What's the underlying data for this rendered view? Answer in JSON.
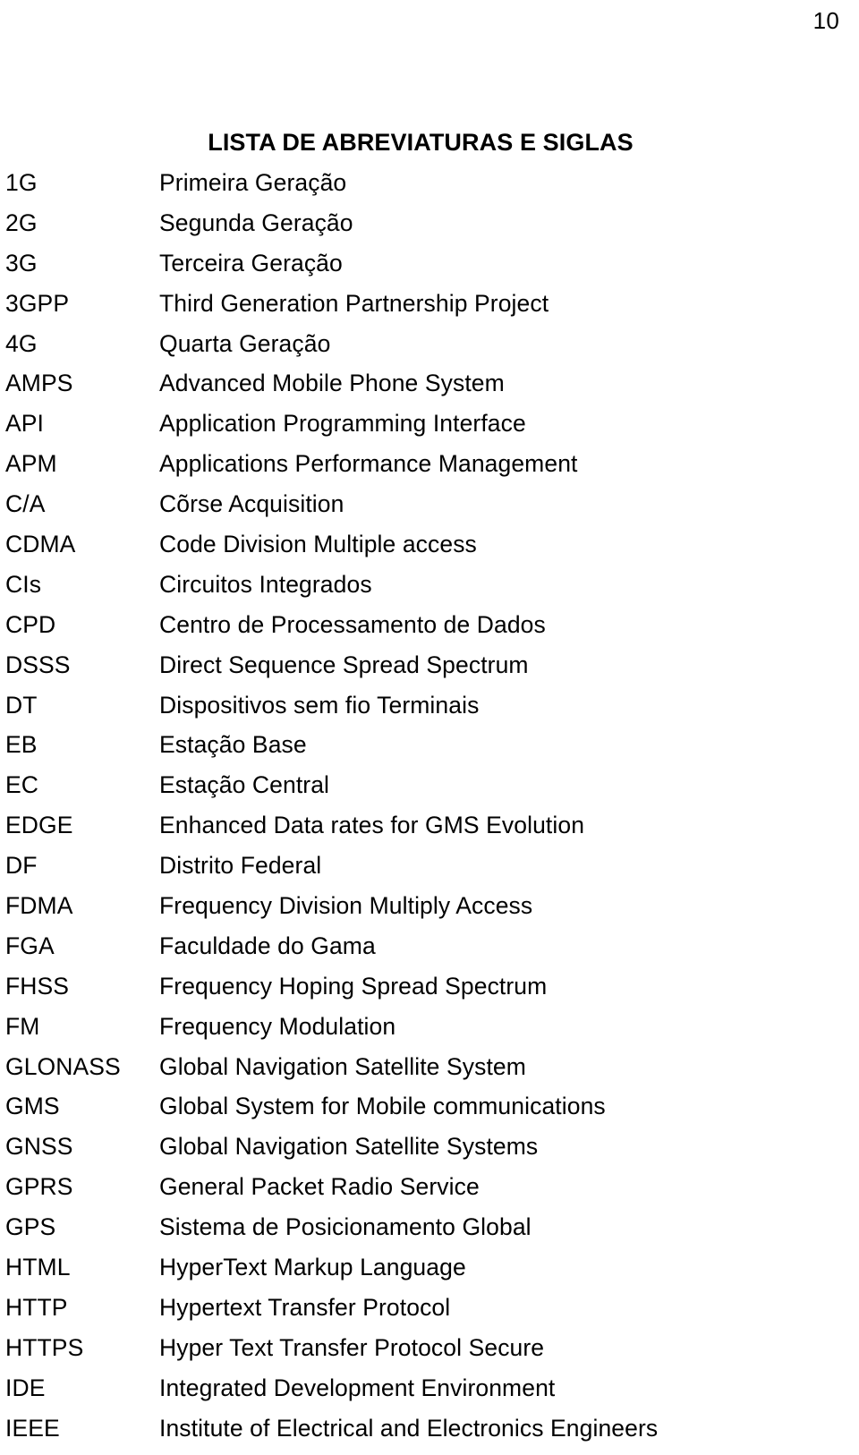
{
  "page": {
    "number": "10",
    "title": "LISTA DE ABREVIATURAS E SIGLAS"
  },
  "abbreviations": [
    {
      "term": "1G",
      "definition": "Primeira Geração"
    },
    {
      "term": "2G",
      "definition": "Segunda Geração"
    },
    {
      "term": "3G",
      "definition": "Terceira Geração"
    },
    {
      "term": "3GPP",
      "definition": "Third Generation Partnership Project"
    },
    {
      "term": "4G",
      "definition": "Quarta Geração"
    },
    {
      "term": "AMPS",
      "definition": "Advanced Mobile Phone System"
    },
    {
      "term": "API",
      "definition": "Application Programming Interface"
    },
    {
      "term": "APM",
      "definition": "Applications Performance Management"
    },
    {
      "term": "C/A",
      "definition": "Cõrse Acquisition"
    },
    {
      "term": "CDMA",
      "definition": "Code Division Multiple access"
    },
    {
      "term": "CIs",
      "definition": "Circuitos Integrados"
    },
    {
      "term": "CPD",
      "definition": "Centro de Processamento de Dados"
    },
    {
      "term": "DSSS",
      "definition": "Direct Sequence Spread Spectrum"
    },
    {
      "term": "DT",
      "definition": "Dispositivos sem fio Terminais"
    },
    {
      "term": "EB",
      "definition": "Estação Base"
    },
    {
      "term": "EC",
      "definition": "Estação Central"
    },
    {
      "term": "EDGE",
      "definition": "Enhanced Data rates for GMS Evolution"
    },
    {
      "term": "DF",
      "definition": "Distrito Federal"
    },
    {
      "term": "FDMA",
      "definition": "Frequency Division Multiply Access"
    },
    {
      "term": "FGA",
      "definition": "Faculdade do Gama"
    },
    {
      "term": "FHSS",
      "definition": "Frequency Hoping Spread Spectrum"
    },
    {
      "term": "FM",
      "definition": "Frequency Modulation"
    },
    {
      "term": "GLONASS",
      "definition": "Global Navigation Satellite System"
    },
    {
      "term": "GMS",
      "definition": "Global System for Mobile communications"
    },
    {
      "term": "GNSS",
      "definition": "Global Navigation Satellite Systems"
    },
    {
      "term": "GPRS",
      "definition": "General Packet Radio Service"
    },
    {
      "term": "GPS",
      "definition": "Sistema de Posicionamento Global"
    },
    {
      "term": "HTML",
      "definition": "HyperText Markup Language"
    },
    {
      "term": "HTTP",
      "definition": "Hypertext Transfer Protocol"
    },
    {
      "term": "HTTPS",
      "definition": "Hyper Text Transfer Protocol Secure"
    },
    {
      "term": "IDE",
      "definition": "Integrated Development Environment"
    },
    {
      "term": "IEEE",
      "definition": "Institute of Electrical and Electronics Engineers"
    }
  ]
}
